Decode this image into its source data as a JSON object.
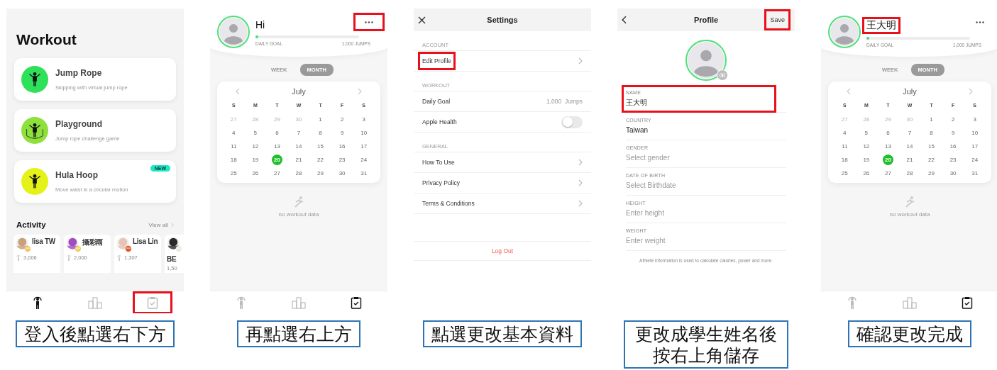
{
  "panels": [
    {
      "kind": "workout",
      "title": "Workout",
      "workouts": [
        {
          "name": "Jump Rope",
          "description": "Skipping with virtual jump rope",
          "color": "#2ee05a"
        },
        {
          "name": "Playground",
          "description": "Jump rope challenge game",
          "color": "#8ee03a"
        },
        {
          "name": "Hula Hoop",
          "description": "Move waist in a circular motion",
          "color": "#e4f21a",
          "badge": "NEW"
        }
      ],
      "activity": {
        "title": "Activity",
        "view_all": "View all",
        "people": [
          {
            "name": "lisa TW",
            "jumps": "3,006"
          },
          {
            "name": "攝彩雨",
            "jumps": "2,000"
          },
          {
            "name": "Lisa Lin",
            "jumps": "1,307"
          },
          {
            "name": "BE",
            "jumps": "1,50"
          }
        ]
      },
      "tabbar": [
        {
          "selected": true,
          "highlighted": false
        },
        {
          "selected": false,
          "highlighted": false
        },
        {
          "selected": false,
          "highlighted": true
        }
      ],
      "caption": "登入後點選右下方"
    },
    {
      "kind": "home",
      "name": {
        "text": "Hi",
        "highlighted": false
      },
      "more": {
        "highlighted": true
      },
      "goal_label": "DAILY GOAL",
      "goal_value": "1,000 JUMPS",
      "level": 0.02,
      "periods": [
        {
          "label": "WEEK",
          "selected": false
        },
        {
          "label": "MONTH",
          "selected": true
        }
      ],
      "calendar": {
        "month": "July",
        "weekdays": [
          "S",
          "M",
          "T",
          "W",
          "T",
          "F",
          "S"
        ],
        "days": [
          {
            "label": "27",
            "muted": true,
            "selected": false
          },
          {
            "label": "28",
            "muted": true,
            "selected": false
          },
          {
            "label": "29",
            "muted": true,
            "selected": false
          },
          {
            "label": "30",
            "muted": true,
            "selected": false
          },
          {
            "label": "1",
            "muted": false,
            "selected": false
          },
          {
            "label": "2",
            "muted": false,
            "selected": false
          },
          {
            "label": "3",
            "muted": false,
            "selected": false
          },
          {
            "label": "4",
            "muted": false,
            "selected": false
          },
          {
            "label": "5",
            "muted": false,
            "selected": false
          },
          {
            "label": "6",
            "muted": false,
            "selected": false
          },
          {
            "label": "7",
            "muted": false,
            "selected": false
          },
          {
            "label": "8",
            "muted": false,
            "selected": false
          },
          {
            "label": "9",
            "muted": false,
            "selected": false
          },
          {
            "label": "10",
            "muted": false,
            "selected": false
          },
          {
            "label": "11",
            "muted": false,
            "selected": false
          },
          {
            "label": "12",
            "muted": false,
            "selected": false
          },
          {
            "label": "13",
            "muted": false,
            "selected": false
          },
          {
            "label": "14",
            "muted": false,
            "selected": false
          },
          {
            "label": "15",
            "muted": false,
            "selected": false
          },
          {
            "label": "16",
            "muted": false,
            "selected": false
          },
          {
            "label": "17",
            "muted": false,
            "selected": false
          },
          {
            "label": "18",
            "muted": false,
            "selected": false
          },
          {
            "label": "19",
            "muted": false,
            "selected": false
          },
          {
            "label": "20",
            "muted": false,
            "selected": true
          },
          {
            "label": "21",
            "muted": false,
            "selected": false
          },
          {
            "label": "22",
            "muted": false,
            "selected": false
          },
          {
            "label": "23",
            "muted": false,
            "selected": false
          },
          {
            "label": "24",
            "muted": false,
            "selected": false
          },
          {
            "label": "25",
            "muted": false,
            "selected": false
          },
          {
            "label": "26",
            "muted": false,
            "selected": false
          },
          {
            "label": "27",
            "muted": false,
            "selected": false
          },
          {
            "label": "28",
            "muted": false,
            "selected": false
          },
          {
            "label": "29",
            "muted": false,
            "selected": false
          },
          {
            "label": "30",
            "muted": false,
            "selected": false
          },
          {
            "label": "31",
            "muted": false,
            "selected": false
          }
        ]
      },
      "empty_text": "no workout data",
      "tabbar": [
        {
          "selected": false,
          "highlighted": false
        },
        {
          "selected": false,
          "highlighted": false
        },
        {
          "selected": true,
          "highlighted": false
        }
      ],
      "caption": "再點選右上方"
    },
    {
      "kind": "settings",
      "title": "Settings",
      "sections": [
        {
          "title": "ACCOUNT",
          "rows": [
            {
              "kind": "link",
              "label": "Edit Profile",
              "highlighted": true
            }
          ]
        },
        {
          "title": "WORKOUT",
          "rows": [
            {
              "kind": "value",
              "label": "Daily Goal",
              "value": "1,000  Jumps",
              "highlighted": false
            },
            {
              "kind": "toggle",
              "label": "Apple Health",
              "on": false,
              "highlighted": false
            }
          ]
        },
        {
          "title": "GENERAL",
          "rows": [
            {
              "kind": "link",
              "label": "How To Use",
              "highlighted": false
            },
            {
              "kind": "link",
              "label": "Privacy Policy",
              "highlighted": false
            },
            {
              "kind": "link",
              "label": "Terms & Conditions",
              "highlighted": false
            }
          ]
        }
      ],
      "logout": "Log Out",
      "caption": "點選更改基本資料"
    },
    {
      "kind": "profile",
      "title": "Profile",
      "save": {
        "label": "Save",
        "highlighted": true
      },
      "fields": [
        {
          "label": "NAME",
          "value": "王大明",
          "highlighted": true
        },
        {
          "label": "COUNTRY",
          "value": "Taiwan",
          "highlighted": false
        },
        {
          "label": "GENDER",
          "placeholder": "Select gender",
          "highlighted": false
        },
        {
          "label": "DATE OF BIRTH",
          "placeholder": "Select Birthdate",
          "highlighted": false
        },
        {
          "label": "HEIGHT",
          "placeholder": "Enter height",
          "highlighted": false
        },
        {
          "label": "WEIGHT",
          "placeholder": "Enter weight",
          "highlighted": false
        }
      ],
      "note": "Athlete information is used to calculate calories, power and more.",
      "caption": "更改成學生姓名後按右上角儲存"
    },
    {
      "kind": "home",
      "name": {
        "text": "王大明",
        "highlighted": true
      },
      "more": {
        "highlighted": false
      },
      "goal_label": "DAILY GOAL",
      "goal_value": "1,000 JUMPS",
      "level": 0.02,
      "periods": [
        {
          "label": "WEEK",
          "selected": false
        },
        {
          "label": "MONTH",
          "selected": true
        }
      ],
      "calendar": {
        "month": "July",
        "weekdays": [
          "S",
          "M",
          "T",
          "W",
          "T",
          "F",
          "S"
        ],
        "days": [
          {
            "label": "27",
            "muted": true,
            "selected": false
          },
          {
            "label": "28",
            "muted": true,
            "selected": false
          },
          {
            "label": "29",
            "muted": true,
            "selected": false
          },
          {
            "label": "30",
            "muted": true,
            "selected": false
          },
          {
            "label": "1",
            "muted": false,
            "selected": false
          },
          {
            "label": "2",
            "muted": false,
            "selected": false
          },
          {
            "label": "3",
            "muted": false,
            "selected": false
          },
          {
            "label": "4",
            "muted": false,
            "selected": false
          },
          {
            "label": "5",
            "muted": false,
            "selected": false
          },
          {
            "label": "6",
            "muted": false,
            "selected": false
          },
          {
            "label": "7",
            "muted": false,
            "selected": false
          },
          {
            "label": "8",
            "muted": false,
            "selected": false
          },
          {
            "label": "9",
            "muted": false,
            "selected": false
          },
          {
            "label": "10",
            "muted": false,
            "selected": false
          },
          {
            "label": "11",
            "muted": false,
            "selected": false
          },
          {
            "label": "12",
            "muted": false,
            "selected": false
          },
          {
            "label": "13",
            "muted": false,
            "selected": false
          },
          {
            "label": "14",
            "muted": false,
            "selected": false
          },
          {
            "label": "15",
            "muted": false,
            "selected": false
          },
          {
            "label": "16",
            "muted": false,
            "selected": false
          },
          {
            "label": "17",
            "muted": false,
            "selected": false
          },
          {
            "label": "18",
            "muted": false,
            "selected": false
          },
          {
            "label": "19",
            "muted": false,
            "selected": false
          },
          {
            "label": "20",
            "muted": false,
            "selected": true
          },
          {
            "label": "21",
            "muted": false,
            "selected": false
          },
          {
            "label": "22",
            "muted": false,
            "selected": false
          },
          {
            "label": "23",
            "muted": false,
            "selected": false
          },
          {
            "label": "24",
            "muted": false,
            "selected": false
          },
          {
            "label": "25",
            "muted": false,
            "selected": false
          },
          {
            "label": "26",
            "muted": false,
            "selected": false
          },
          {
            "label": "27",
            "muted": false,
            "selected": false
          },
          {
            "label": "28",
            "muted": false,
            "selected": false
          },
          {
            "label": "29",
            "muted": false,
            "selected": false
          },
          {
            "label": "30",
            "muted": false,
            "selected": false
          },
          {
            "label": "31",
            "muted": false,
            "selected": false
          }
        ]
      },
      "empty_text": "no workout data",
      "tabbar": [
        {
          "selected": false,
          "highlighted": false
        },
        {
          "selected": false,
          "highlighted": false
        },
        {
          "selected": true,
          "highlighted": false
        }
      ],
      "caption": "確認更改完成"
    }
  ]
}
